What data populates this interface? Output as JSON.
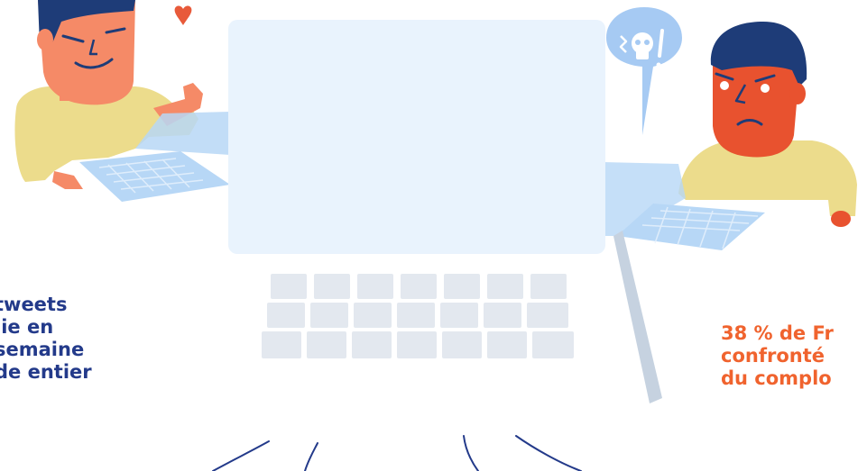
{
  "illustration": {
    "left_caption": {
      "lines": [
        "tweets",
        "lie en",
        "semaine",
        "de entier"
      ]
    },
    "right_caption": {
      "lines": [
        "38 % de Fr",
        "confronté",
        "du complo"
      ]
    },
    "colors": {
      "skin_left": "#f58a67",
      "skin_right": "#e8522f",
      "hair": "#1e3c78",
      "shirt": "#ecdc8c",
      "laptop": "#b7d7f6",
      "screen": "#e9f3fd",
      "keyboard": "#e3e8ef",
      "stand": "#c6d2e0",
      "accent_blue": "#233a8a",
      "accent_orange": "#f0632e",
      "heart": "#e85a3a",
      "bubble": "#a6caf3"
    },
    "icons": [
      "heart-icon",
      "skull-icon"
    ]
  }
}
